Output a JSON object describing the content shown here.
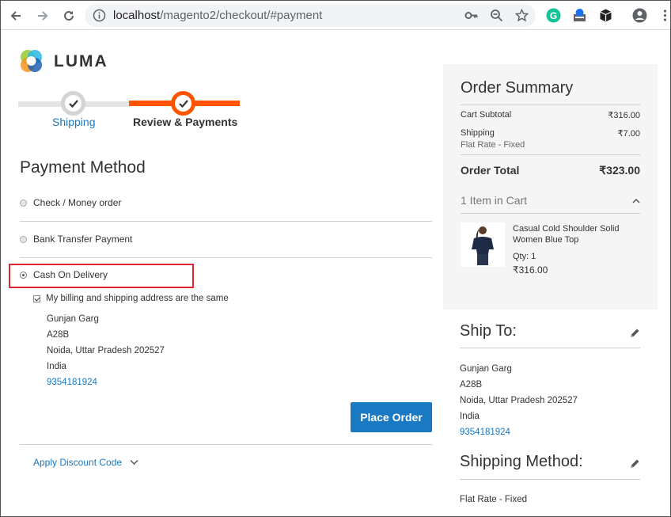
{
  "browser": {
    "url_host": "localhost",
    "url_path": "/magento2/checkout/#payment"
  },
  "brand": {
    "name": "LUMA"
  },
  "progress": {
    "steps": [
      {
        "label": "Shipping"
      },
      {
        "label": "Review & Payments"
      }
    ]
  },
  "payment": {
    "title": "Payment Method",
    "options": [
      {
        "label": "Check / Money order"
      },
      {
        "label": "Bank Transfer Payment"
      },
      {
        "label": "Cash On Delivery"
      }
    ],
    "same_address_label": "My billing and shipping address are the same",
    "address": {
      "name": "Gunjan Garg",
      "line1": "A28B",
      "city_line": "Noida, Uttar Pradesh 202527",
      "country": "India",
      "phone": "9354181924"
    },
    "place_order_label": "Place Order",
    "discount_label": "Apply Discount Code"
  },
  "summary": {
    "title": "Order Summary",
    "cart_subtotal_label": "Cart Subtotal",
    "cart_subtotal_value": "₹316.00",
    "shipping_label": "Shipping",
    "shipping_value": "₹7.00",
    "shipping_method": "Flat Rate - Fixed",
    "order_total_label": "Order Total",
    "order_total_value": "₹323.00",
    "items_in_cart": "1 Item in Cart",
    "product": {
      "name": "Casual Cold Shoulder Solid Women Blue Top",
      "qty": "Qty: 1",
      "price": "₹316.00"
    }
  },
  "ship_to": {
    "title": "Ship To:",
    "name": "Gunjan Garg",
    "line1": "A28B",
    "city_line": "Noida, Uttar Pradesh 202527",
    "country": "India",
    "phone": "9354181924"
  },
  "shipping_method": {
    "title": "Shipping Method:",
    "value": "Flat Rate - Fixed"
  },
  "colors": {
    "accent": "#ff5501",
    "link": "#1979c3",
    "highlight": "#e0262f"
  }
}
